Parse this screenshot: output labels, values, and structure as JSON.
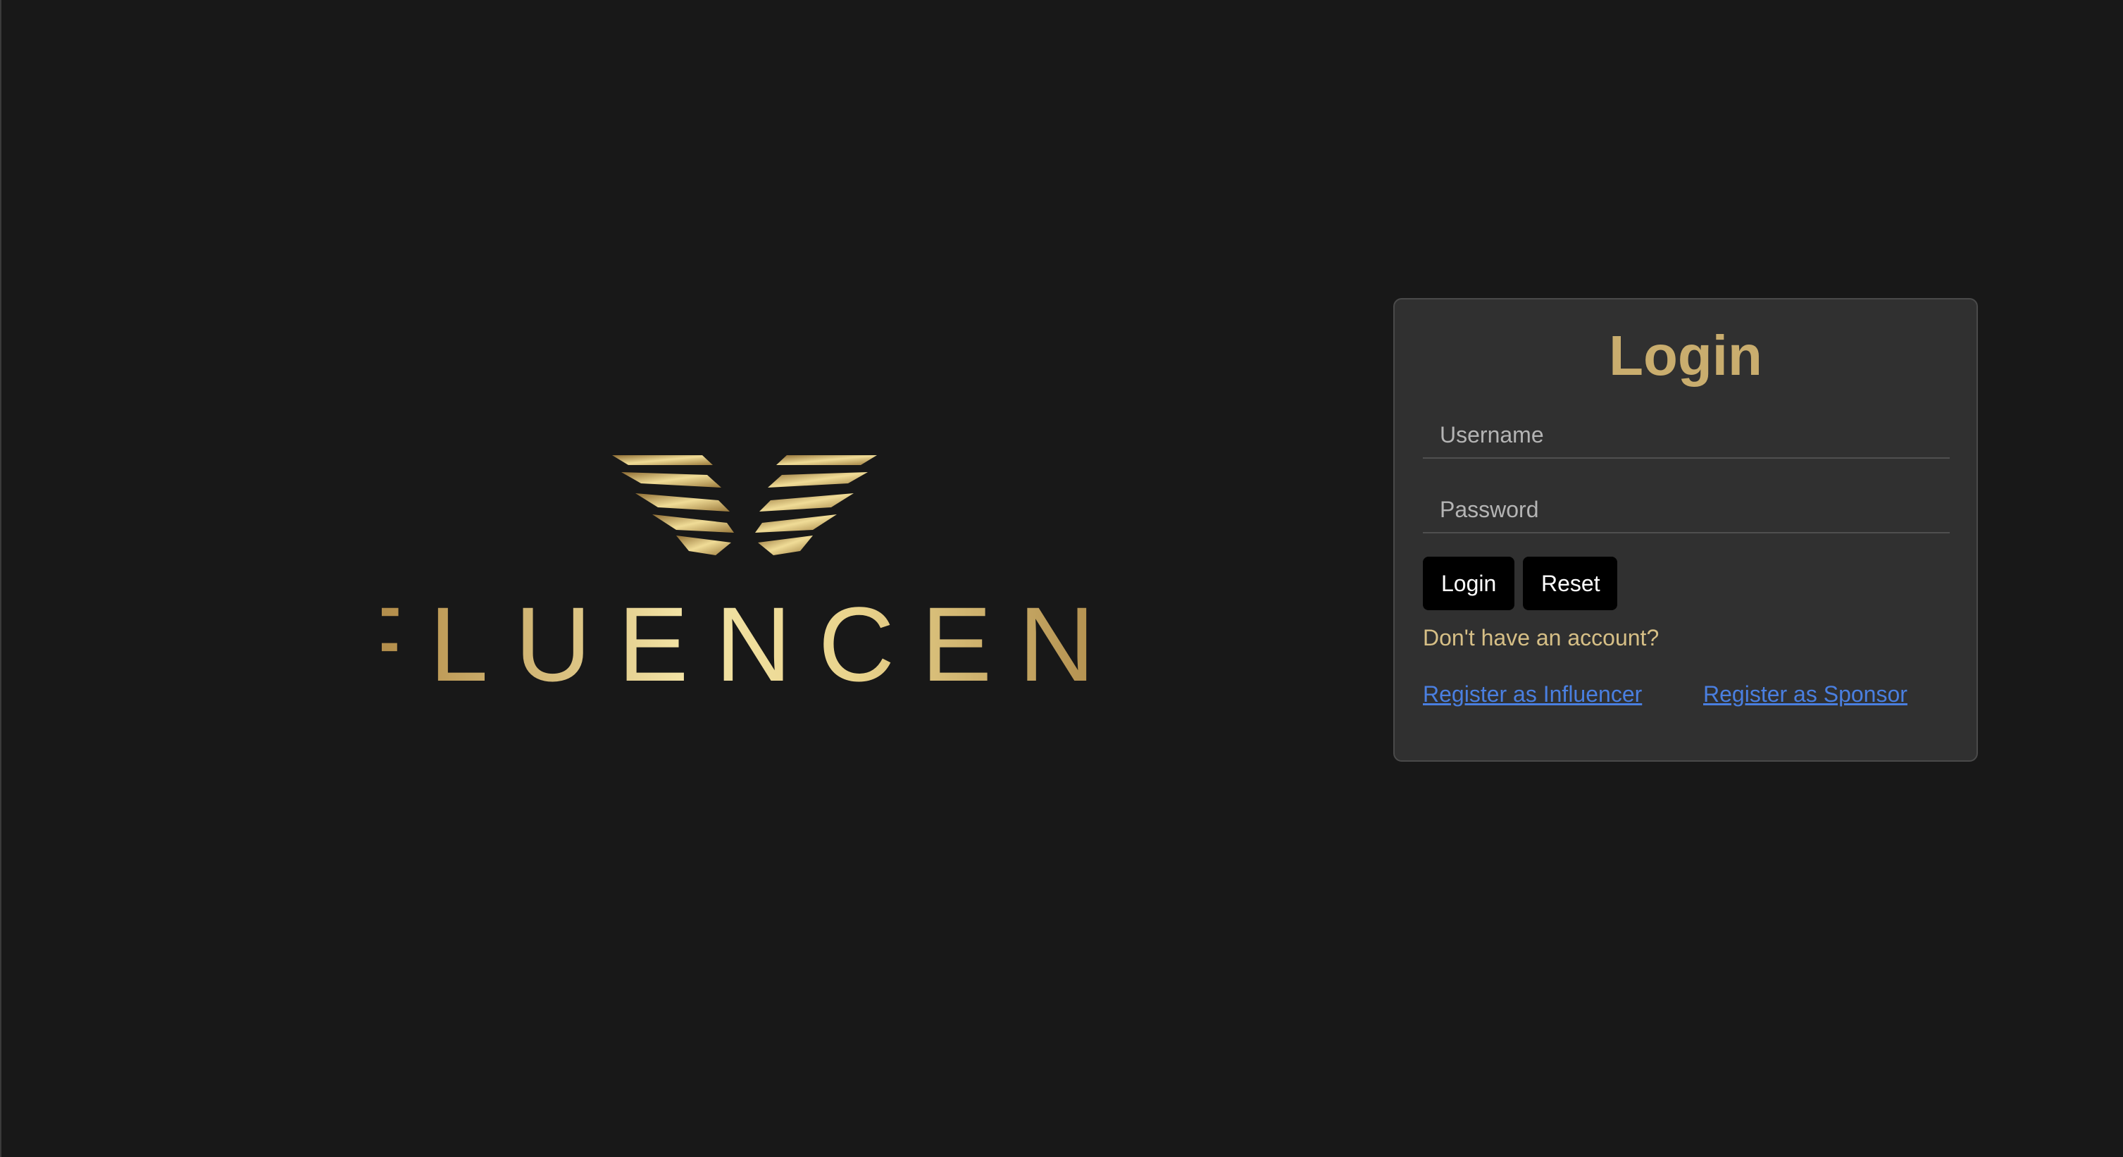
{
  "brand": {
    "logo_text": "INFLUENCENET",
    "logo_icon": "wings-icon",
    "accent_color": "#c9ad6e"
  },
  "login": {
    "title": "Login",
    "username_placeholder": "Username",
    "username_value": "",
    "password_placeholder": "Password",
    "password_value": "",
    "login_button": "Login",
    "reset_button": "Reset",
    "no_account_text": "Don't have an account?",
    "register_influencer": "Register as Influencer",
    "register_sponsor": "Register as Sponsor"
  },
  "colors": {
    "background": "#181818",
    "card": "#303030",
    "link": "#4a7fe0",
    "button": "#000000"
  }
}
